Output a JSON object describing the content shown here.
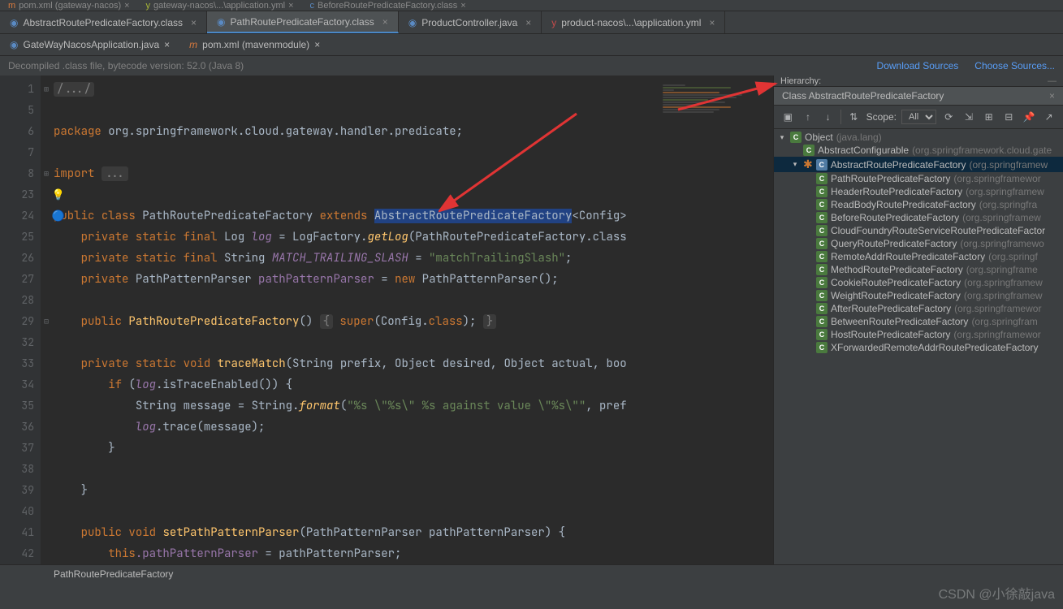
{
  "top_tabs": [
    {
      "label": "pom.xml (gateway-nacos)",
      "icon": "maven"
    },
    {
      "label": "gateway-nacos\\...\\application.yml",
      "icon": "yml"
    },
    {
      "label": "BeforeRoutePredicateFactory.class",
      "icon": "class"
    }
  ],
  "main_tabs": [
    {
      "label": "AbstractRoutePredicateFactory.class",
      "icon": "class",
      "active": false
    },
    {
      "label": "PathRoutePredicateFactory.class",
      "icon": "class",
      "active": true
    },
    {
      "label": "ProductController.java",
      "icon": "java",
      "active": false
    },
    {
      "label": "product-nacos\\...\\application.yml",
      "icon": "yml",
      "active": false
    }
  ],
  "sub_tabs": [
    {
      "label": "GateWayNacosApplication.java",
      "icon": "java"
    },
    {
      "label": "pom.xml (mavenmodule)",
      "icon": "maven"
    }
  ],
  "info_bar": {
    "text": "Decompiled .class file, bytecode version: 52.0 (Java 8)",
    "link1": "Download Sources",
    "link2": "Choose Sources..."
  },
  "code": {
    "lines": [
      1,
      5,
      6,
      7,
      8,
      23,
      24,
      25,
      26,
      27,
      28,
      29,
      32,
      33,
      34,
      35,
      36,
      37,
      38,
      39,
      40,
      41,
      42
    ],
    "l1": "/.../",
    "l6_pkg": "package",
    "l6_val": "org.springframework.cloud.gateway.handler.predicate",
    "l8_imp": "import",
    "l8_dots": "...",
    "l24_public": "public",
    "l24_class": "class",
    "l24_name": "PathRoutePredicateFactory",
    "l24_extends": "extends",
    "l24_super": "AbstractRoutePredicateFactory",
    "l24_gen": "<Config>",
    "l25_mods": "private static final",
    "l25_type": "Log",
    "l25_name": "log",
    "l25_eq": " = LogFactory.",
    "l25_m": "getLog",
    "l25_arg": "(PathRoutePredicateFactory.class",
    "l26_mods": "private static final",
    "l26_type": "String",
    "l26_name": "MATCH_TRAILING_SLASH",
    "l26_eq": " = ",
    "l26_str": "\"matchTrailingSlash\"",
    "l27_mods": "private",
    "l27_type": "PathPatternParser",
    "l27_name": "pathPatternParser",
    "l27_eq": " = ",
    "l27_new": "new",
    "l27_ctor": " PathPatternParser();",
    "l29_public": "public",
    "l29_name": "PathRoutePredicateFactory",
    "l29_body": "() ",
    "l29_lb": "{",
    "l29_super": " super",
    "l29_arg": "(Config.",
    "l29_class": "class",
    "l29_end": "); ",
    "l29_rb": "}",
    "l33_mods": "private static",
    "l33_void": "void",
    "l33_name": "traceMatch",
    "l33_params": "(String prefix, Object desired, Object actual, boo",
    "l34_if": "if",
    "l34_cond": " (",
    "l34_log": "log",
    "l34_m": ".isTraceEnabled()) {",
    "l35_decl": "String message = String.",
    "l35_m": "format",
    "l35_args": "(",
    "l35_str": "\"%s \\\"%s\\\" %s against value \\\"%s\\\"\"",
    "l35_rest": ", pref",
    "l36_log": "log",
    "l36_m": ".trace(message);",
    "l37_cb": "}",
    "l39_cb": "}",
    "l41_public": "public",
    "l41_void": "void",
    "l41_name": "setPathPatternParser",
    "l41_params": "(PathPatternParser pathPatternParser) {",
    "l42_this": "this",
    "l42_field": ".pathPatternParser",
    "l42_rest": " = pathPatternParser;"
  },
  "hierarchy": {
    "title": "Hierarchy:",
    "tab_name": "Class AbstractRoutePredicateFactory",
    "scope_label": "Scope:",
    "scope_value": "All",
    "nodes": [
      {
        "indent": 0,
        "arrow": "v",
        "ico": "C",
        "name": "Object",
        "pkg": "(java.lang)",
        "type": "class-c"
      },
      {
        "indent": 1,
        "arrow": "",
        "ico": "C",
        "name": "AbstractConfigurable",
        "pkg": "(org.springframework.cloud.gate",
        "type": "class-c"
      },
      {
        "indent": 1,
        "arrow": "v",
        "ico": "C",
        "name": "AbstractRoutePredicateFactory",
        "pkg": "(org.springframew",
        "type": "abs",
        "selected": true,
        "star": true
      },
      {
        "indent": 2,
        "arrow": "",
        "ico": "C",
        "name": "PathRoutePredicateFactory",
        "pkg": "(org.springframewor",
        "type": "class-c"
      },
      {
        "indent": 2,
        "arrow": "",
        "ico": "C",
        "name": "HeaderRoutePredicateFactory",
        "pkg": "(org.springframew",
        "type": "class-c"
      },
      {
        "indent": 2,
        "arrow": "",
        "ico": "C",
        "name": "ReadBodyRoutePredicateFactory",
        "pkg": "(org.springfra",
        "type": "class-c"
      },
      {
        "indent": 2,
        "arrow": "",
        "ico": "C",
        "name": "BeforeRoutePredicateFactory",
        "pkg": "(org.springframew",
        "type": "class-c"
      },
      {
        "indent": 2,
        "arrow": "",
        "ico": "C",
        "name": "CloudFoundryRouteServiceRoutePredicateFactor",
        "pkg": "",
        "type": "class-c"
      },
      {
        "indent": 2,
        "arrow": "",
        "ico": "C",
        "name": "QueryRoutePredicateFactory",
        "pkg": "(org.springframewo",
        "type": "class-c"
      },
      {
        "indent": 2,
        "arrow": "",
        "ico": "C",
        "name": "RemoteAddrRoutePredicateFactory",
        "pkg": "(org.springf",
        "type": "class-c"
      },
      {
        "indent": 2,
        "arrow": "",
        "ico": "C",
        "name": "MethodRoutePredicateFactory",
        "pkg": "(org.springframe",
        "type": "class-c"
      },
      {
        "indent": 2,
        "arrow": "",
        "ico": "C",
        "name": "CookieRoutePredicateFactory",
        "pkg": "(org.springframew",
        "type": "class-c"
      },
      {
        "indent": 2,
        "arrow": "",
        "ico": "C",
        "name": "WeightRoutePredicateFactory",
        "pkg": "(org.springframew",
        "type": "class-c"
      },
      {
        "indent": 2,
        "arrow": "",
        "ico": "C",
        "name": "AfterRoutePredicateFactory",
        "pkg": "(org.springframewor",
        "type": "class-c"
      },
      {
        "indent": 2,
        "arrow": "",
        "ico": "C",
        "name": "BetweenRoutePredicateFactory",
        "pkg": "(org.springfram",
        "type": "class-c"
      },
      {
        "indent": 2,
        "arrow": "",
        "ico": "C",
        "name": "HostRoutePredicateFactory",
        "pkg": "(org.springframewor",
        "type": "class-c"
      },
      {
        "indent": 2,
        "arrow": "",
        "ico": "C",
        "name": "XForwardedRemoteAddrRoutePredicateFactory",
        "pkg": "",
        "type": "class-c"
      }
    ]
  },
  "breadcrumb": "PathRoutePredicateFactory",
  "watermark": "CSDN @小徐敲java"
}
